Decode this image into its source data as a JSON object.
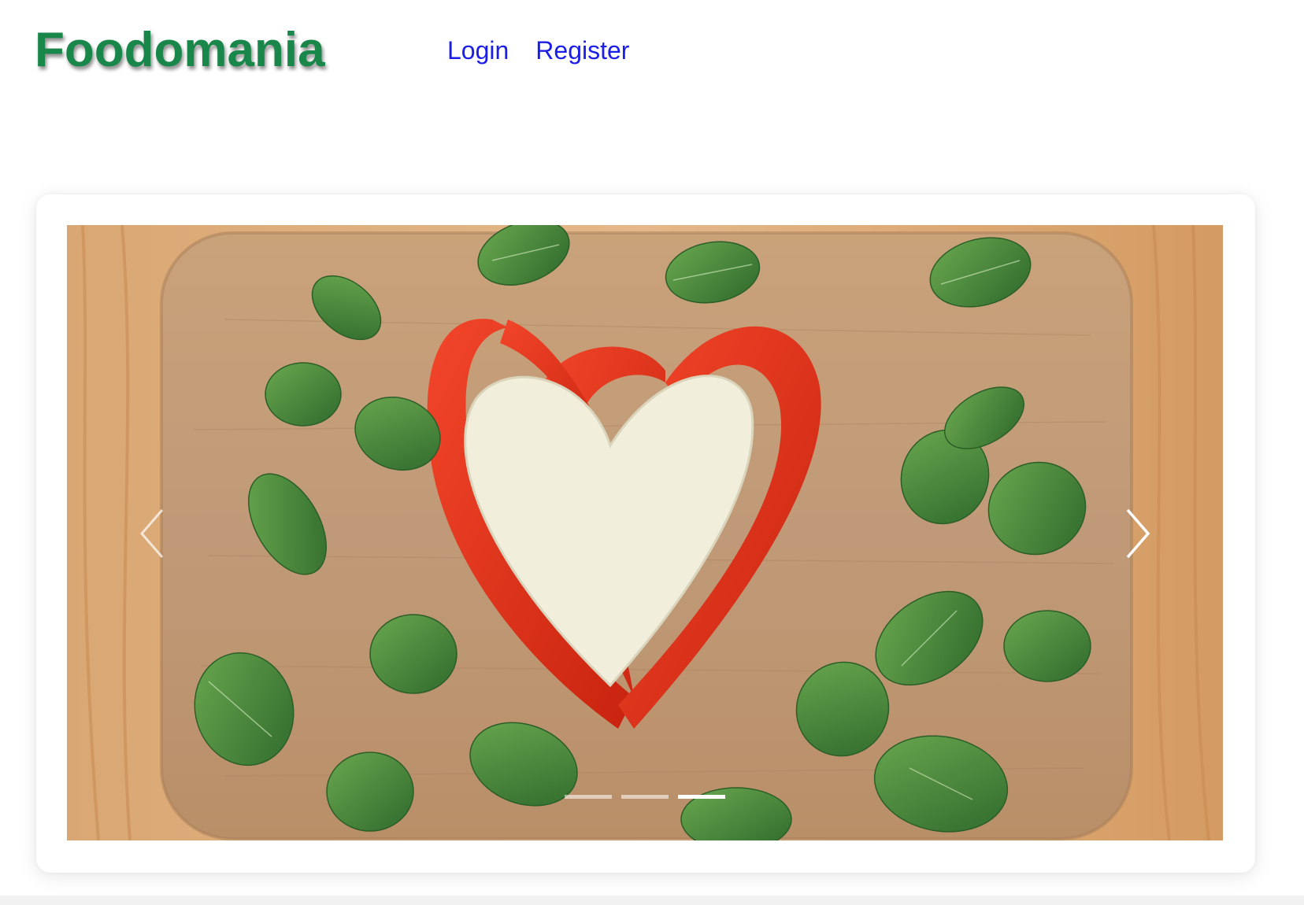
{
  "header": {
    "logo_text": "Foodomania",
    "nav": [
      {
        "label": "Login"
      },
      {
        "label": "Register"
      }
    ]
  },
  "carousel": {
    "slide_count": 3,
    "active_index": 2,
    "prev_icon": "chevron-left-icon",
    "next_icon": "chevron-right-icon"
  },
  "colors": {
    "logo": "#19874a",
    "nav_link": "#1a1ee6",
    "background": "#ffffff"
  }
}
